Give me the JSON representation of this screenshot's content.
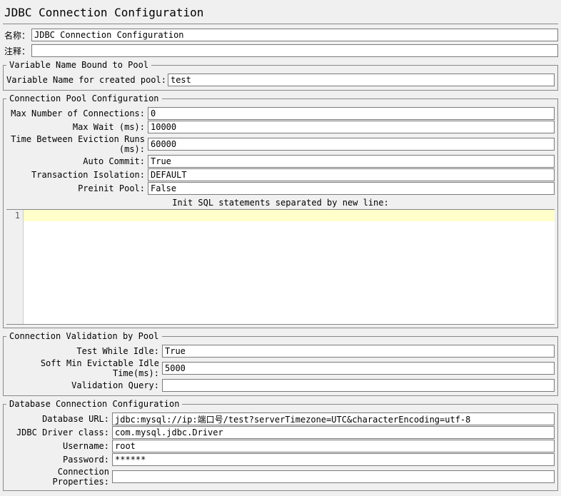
{
  "title": "JDBC Connection Configuration",
  "topFields": {
    "nameLabel": "名称：",
    "nameValue": "JDBC Connection Configuration",
    "commentLabel": "注释："
  },
  "varSection": {
    "legend": "Variable Name Bound to Pool",
    "label": "Variable Name for created pool:",
    "value": "test"
  },
  "poolSection": {
    "legend": "Connection Pool Configuration",
    "maxConnLabel": "Max Number of Connections:",
    "maxConnValue": "0",
    "maxWaitLabel": "Max Wait (ms):",
    "maxWaitValue": "10000",
    "evictLabel": "Time Between Eviction Runs (ms):",
    "evictValue": "60000",
    "autoCommitLabel": "Auto Commit:",
    "autoCommitValue": "True",
    "txIsoLabel": "Transaction Isolation:",
    "txIsoValue": "DEFAULT",
    "preinitLabel": "Preinit Pool:",
    "preinitValue": "False",
    "initSqlLabel": "Init SQL statements separated by new line:",
    "lineNumber": "1"
  },
  "validationSection": {
    "legend": "Connection Validation by Pool",
    "testIdleLabel": "Test While Idle:",
    "testIdleValue": "True",
    "softMinLabel": "Soft Min Evictable Idle Time(ms):",
    "softMinValue": "5000",
    "valQueryLabel": "Validation Query:",
    "valQueryValue": ""
  },
  "dbSection": {
    "legend": "Database Connection Configuration",
    "urlLabel": "Database URL:",
    "urlValue": "jdbc:mysql://ip:端口号/test?serverTimezone=UTC&characterEncoding=utf-8",
    "driverLabel": "JDBC Driver class:",
    "driverValue": "com.mysql.jdbc.Driver",
    "userLabel": "Username:",
    "userValue": "root",
    "passLabel": "Password:",
    "passValue": "******",
    "connPropsLabel": "Connection Properties:",
    "connPropsValue": ""
  }
}
